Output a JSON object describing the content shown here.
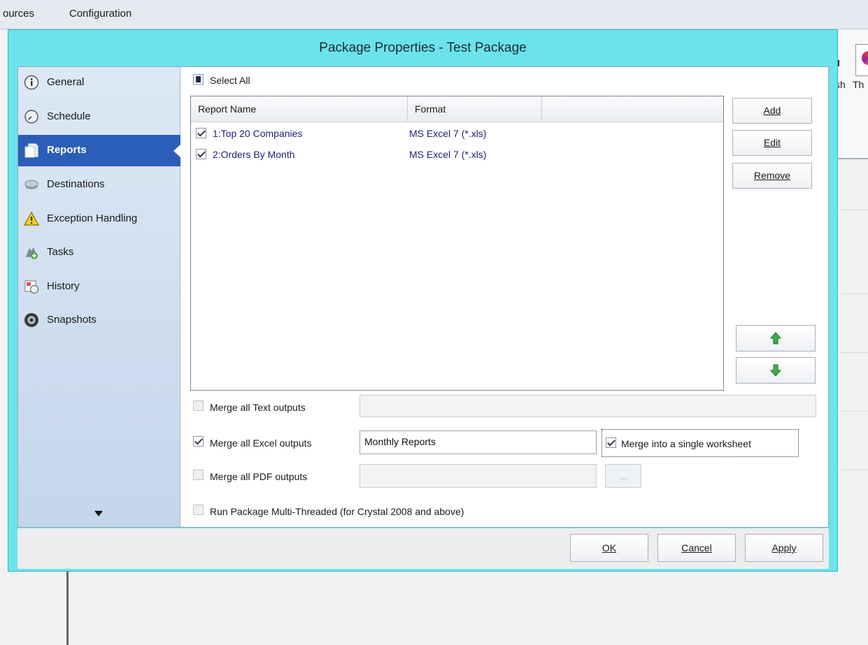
{
  "app": {
    "menu": [
      "ources",
      "Configuration"
    ],
    "ribbon_partial_labels": [
      "sh",
      "Th"
    ]
  },
  "dialog": {
    "title": "Package Properties - Test Package",
    "nav": [
      {
        "label": "General",
        "icon": "info-icon"
      },
      {
        "label": "Schedule",
        "icon": "clock-icon"
      },
      {
        "label": "Reports",
        "icon": "reports-icon",
        "active": true
      },
      {
        "label": "Destinations",
        "icon": "destinations-icon"
      },
      {
        "label": "Exception Handling",
        "icon": "warning-icon"
      },
      {
        "label": "Tasks",
        "icon": "tasks-icon"
      },
      {
        "label": "History",
        "icon": "history-icon"
      },
      {
        "label": "Snapshots",
        "icon": "camera-icon"
      }
    ],
    "select_all": {
      "label": "Select All",
      "state": "indeterminate"
    },
    "report_list": {
      "columns": [
        "Report Name",
        "Format"
      ],
      "rows": [
        {
          "checked": true,
          "name": "1:Top 20 Companies",
          "format": "MS Excel 7 (*.xls)"
        },
        {
          "checked": true,
          "name": "2:Orders By Month",
          "format": "MS Excel 7 (*.xls)"
        }
      ]
    },
    "side_buttons": {
      "add": "Add",
      "edit": "Edit",
      "remove": "Remove"
    },
    "move_buttons": {
      "up_icon": "arrow-up-icon",
      "down_icon": "arrow-down-icon",
      "color": "#3cb043"
    },
    "merge": {
      "text": {
        "label": "Merge all Text outputs",
        "checked": false,
        "value": ""
      },
      "excel": {
        "label": "Merge all Excel outputs",
        "checked": true,
        "value": "Monthly Reports",
        "single_worksheet": {
          "label": "Merge into a single worksheet",
          "checked": true
        }
      },
      "pdf": {
        "label": "Merge all PDF outputs",
        "checked": false,
        "value": "",
        "browse": "..."
      }
    },
    "multi_threaded": {
      "label": "Run Package Multi-Threaded (for Crystal 2008 and above)",
      "checked": false
    },
    "footer": {
      "ok": "OK",
      "cancel": "Cancel",
      "apply": "Apply"
    }
  },
  "colors": {
    "dialog_frame": "#6be3ea",
    "nav_active": "#2b5eb8",
    "list_text": "#20207a"
  }
}
